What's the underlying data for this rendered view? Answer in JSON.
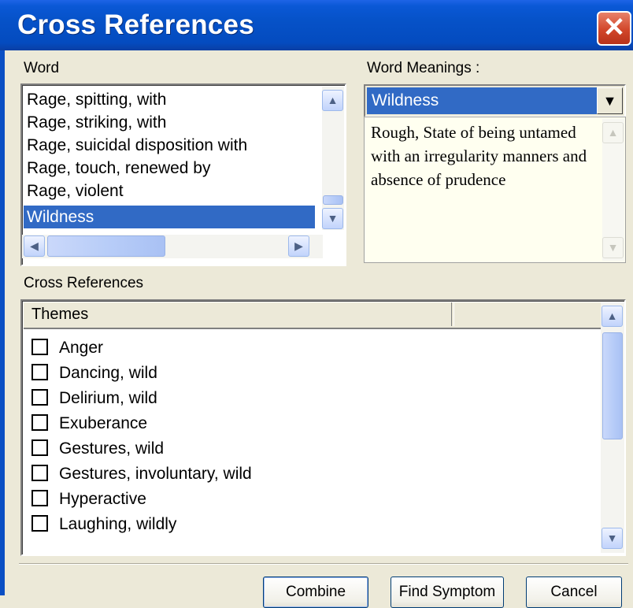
{
  "window": {
    "title": "Cross References",
    "close_glyph": "✕"
  },
  "word_panel": {
    "label": "Word",
    "items": [
      "Rage, spitting, with",
      "Rage, striking, with",
      "Rage, suicidal disposition with",
      "Rage, touch, renewed by",
      "Rage, violent",
      "Wildness"
    ],
    "selected": "Wildness"
  },
  "meanings_panel": {
    "label": "Word Meanings :",
    "combo_value": "Wildness",
    "definition": "Rough, State of being untamed with an irregularity manners and absence of prudence"
  },
  "cross_refs": {
    "label": "Cross References",
    "column_header": "Themes",
    "items": [
      "Anger",
      "Dancing, wild",
      "Delirium, wild",
      "Exuberance",
      "Gestures, wild",
      "Gestures, involuntary, wild",
      "Hyperactive",
      "Laughing, wildly"
    ]
  },
  "buttons": {
    "combine": "Combine",
    "find_symptom": "Find Symptom",
    "cancel": "Cancel"
  },
  "icons": {
    "up": "up-arrow-icon",
    "down": "down-arrow-icon",
    "left": "left-arrow-icon",
    "right": "right-arrow-icon",
    "dropdown": "dropdown-arrow-icon",
    "close": "close-icon"
  },
  "colors": {
    "titlebar": "#0652c8",
    "selection": "#316ac5",
    "dialog_bg": "#ece9d8",
    "close_button": "#d2462a"
  }
}
